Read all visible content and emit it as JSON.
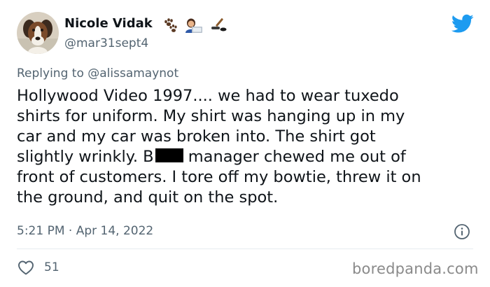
{
  "user": {
    "display_name": "Nicole Vidak",
    "handle": "@mar31sept4",
    "name_emojis": [
      "paw-prints-icon",
      "woman-technologist-icon",
      "hockey-stick-icon"
    ]
  },
  "reply": {
    "prefix": "Replying to",
    "mention": "@alissamaynot"
  },
  "tweet": {
    "lines": [
      "Hollywood Video 1997.... we had to wear tuxedo",
      "shirts for uniform. My shirt was hanging up in my",
      "car and my car was broken into. The shirt got",
      "slightly wrinkly. B",
      " manager chewed me out of",
      "front of customers. I tore off my bowtie, threw it on",
      "the ground, and quit on the spot."
    ]
  },
  "meta": {
    "time": "5:21 PM",
    "separator": "·",
    "date": "Apr 14, 2022"
  },
  "engagement": {
    "likes": "51"
  },
  "watermark": "boredpanda.com",
  "colors": {
    "twitter_blue": "#1d9bf0",
    "text": "#0f1419",
    "secondary": "#536471"
  }
}
